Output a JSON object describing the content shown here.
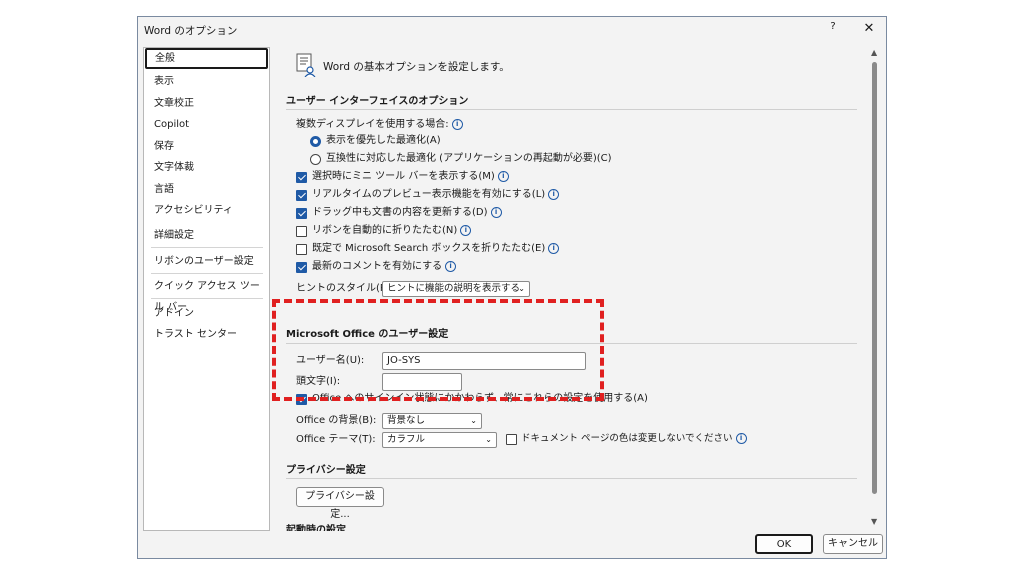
{
  "window": {
    "title": "Word のオプション",
    "help": "?",
    "close": "✕"
  },
  "nav": {
    "items": [
      "全般",
      "表示",
      "文章校正",
      "Copilot",
      "保存",
      "文字体裁",
      "言語",
      "アクセシビリティ",
      "詳細設定",
      "リボンのユーザー設定",
      "クイック アクセス ツール バー",
      "アドイン",
      "トラスト センター"
    ],
    "selected": "全般"
  },
  "header": {
    "text": "Word の基本オプションを設定します。"
  },
  "ui_section": {
    "title": "ユーザー インターフェイスのオプション",
    "multi_display_label": "複数ディスプレイを使用する場合:",
    "radio_optimize_appearance": "表示を優先した最適化(A)",
    "radio_optimize_compat": "互換性に対応した最適化 (アプリケーションの再起動が必要)(C)",
    "cb_mini_toolbar": "選択時にミニ ツール バーを表示する(M)",
    "cb_live_preview": "リアルタイムのプレビュー表示機能を有効にする(L)",
    "cb_drag_update": "ドラッグ中も文書の内容を更新する(D)",
    "cb_collapse_ribbon": "リボンを自動的に折りたたむ(N)",
    "cb_search_box": "既定で Microsoft Search ボックスを折りたたむ(E)",
    "cb_modern_comments": "最新のコメントを有効にする",
    "tooltip_style_label": "ヒントのスタイル(R):",
    "tooltip_style_value": "ヒントに機能の説明を表示する"
  },
  "personalize": {
    "title": "Microsoft Office のユーザー設定",
    "username_label": "ユーザー名(U):",
    "username_value": "JO-SYS",
    "initials_label": "頭文字(I):",
    "initials_value": "",
    "cb_always_use": "Office へのサインイン状態にかかわらず、常にこれらの設定を使用する(A)",
    "background_label": "Office の背景(B):",
    "background_value": "背景なし",
    "theme_label": "Office テーマ(T):",
    "theme_value": "カラフル",
    "cb_no_page_color": "ドキュメント ページの色は変更しないでください"
  },
  "privacy": {
    "title": "プライバシー設定",
    "button": "プライバシー設定..."
  },
  "startup": {
    "title": "起動時の設定"
  },
  "footer": {
    "ok": "OK",
    "cancel": "キャンセル"
  },
  "checkbox_state": {
    "mini_toolbar": true,
    "live_preview": true,
    "drag_update": true,
    "collapse_ribbon": false,
    "search_box": false,
    "modern_comments": true,
    "always_use": true,
    "no_page_color": false
  },
  "colors": {
    "accent": "#1f5aa6",
    "highlight": "#e02020"
  },
  "icons": [
    "help-icon",
    "close-icon",
    "options-header-icon",
    "info-icon",
    "chevron-down-icon",
    "scroll-up-icon",
    "scroll-down-icon"
  ]
}
